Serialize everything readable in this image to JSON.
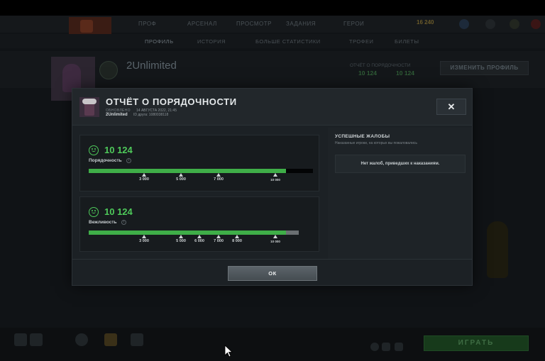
{
  "background": {
    "nav": [
      "ПРОФ",
      "АРСЕНАЛ",
      "ПРОСМОТР",
      "ЗАДАНИЯ",
      "ГЕРОИ"
    ],
    "coins": "16 240",
    "subnav": [
      "ПРОФИЛЬ",
      "ИСТОРИЯ",
      "БОЛЬШЕ СТАТИСТИКИ",
      "ТРОФЕИ",
      "БИЛЕТЫ"
    ],
    "profile_name": "2Unlimited",
    "conduct_label": "ОТЧЁТ О ПОРЯДОЧНОСТИ",
    "conduct_values": [
      "10 124",
      "10 124"
    ],
    "edit_profile_button": "ИЗМЕНИТЬ ПРОФИЛЬ",
    "play_button": "ИГРАТЬ"
  },
  "modal": {
    "title": "ОТЧЁТ О ПОРЯДОЧНОСТИ",
    "updated_label": "ОБНОВЛЕНО",
    "updated_date": "14 АВГУСТА 2022, 21:45",
    "username": "2Unlimited",
    "friend_id": "ID друга: 1080038118",
    "close_label": "✕",
    "conduct": {
      "score": "10 124",
      "label": "Порядочность",
      "level": 10124,
      "ticks": [
        "3 000",
        "5 000",
        "7 000",
        "10 000"
      ]
    },
    "politeness": {
      "score": "10 124",
      "label": "Вежливость",
      "level": 10124,
      "ticks": [
        "3 000",
        "5 000",
        "6 000",
        "7 000",
        "8 000",
        "10 000"
      ]
    },
    "reports_title": "УСПЕШНЫЕ ЖАЛОБЫ",
    "reports_subtitle": "Наказанные игроки, на которых вы пожаловались",
    "no_reports": "Нет жалоб, приведших к наказаниям.",
    "ok_label": "ОК"
  }
}
